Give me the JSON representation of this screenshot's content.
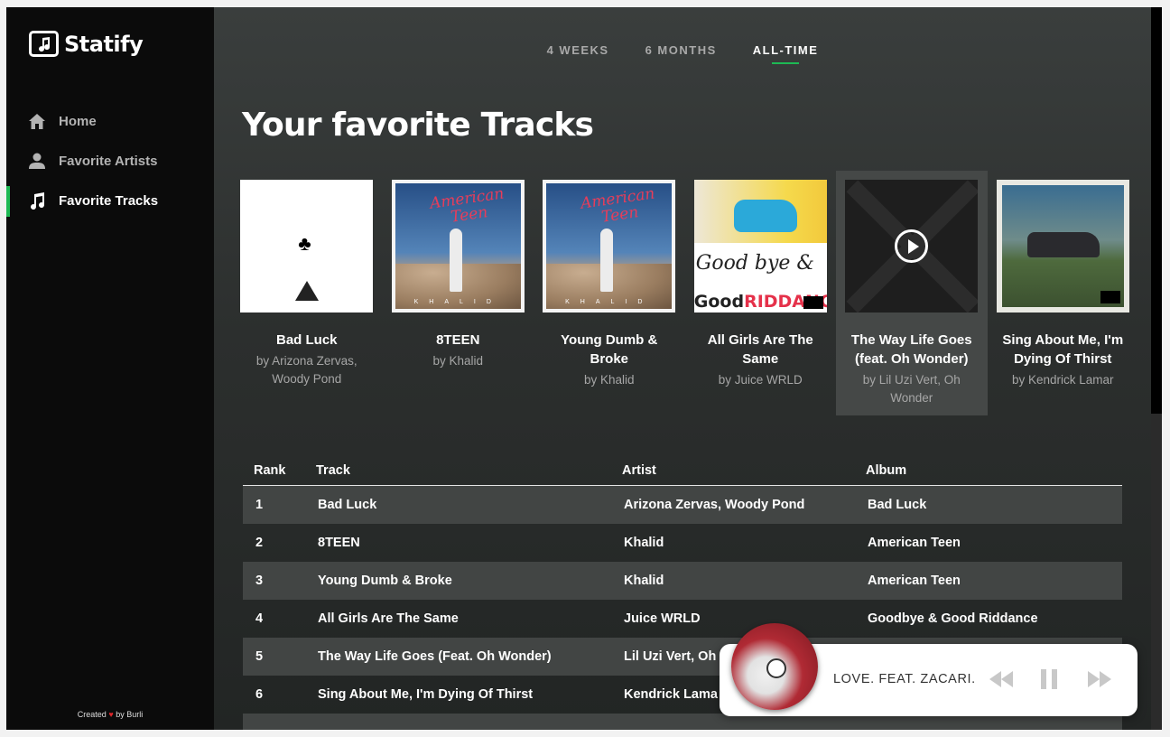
{
  "app": {
    "name": "Statify"
  },
  "sidebar": {
    "items": [
      {
        "label": "Home",
        "icon": "home-icon",
        "active": false
      },
      {
        "label": "Favorite Artists",
        "icon": "person-icon",
        "active": false
      },
      {
        "label": "Favorite Tracks",
        "icon": "music-note-icon",
        "active": true
      }
    ],
    "credit": {
      "prefix": "Created",
      "suffix": "by Burli"
    }
  },
  "tabs": [
    {
      "label": "4 WEEKS",
      "active": false
    },
    {
      "label": "6 MONTHS",
      "active": false
    },
    {
      "label": "ALL-TIME",
      "active": true
    }
  ],
  "page_title": "Your favorite Tracks",
  "cards": [
    {
      "title": "Bad Luck",
      "artist": "by Arizona Zervas, Woody Pond"
    },
    {
      "title": "8TEEN",
      "artist": "by Khalid"
    },
    {
      "title": "Young Dumb & Broke",
      "artist": "by Khalid"
    },
    {
      "title": "All Girls Are The Same",
      "artist": "by Juice WRLD"
    },
    {
      "title": "The Way Life Goes (feat. Oh Wonder)",
      "artist": "by Lil Uzi Vert, Oh Wonder"
    },
    {
      "title": "Sing About Me, I'm Dying Of Thirst",
      "artist": "by Kendrick Lamar"
    }
  ],
  "covers": {
    "american_teen_script": "American Teen",
    "khalid_letters": "KHALID",
    "goodbye_script": "Good bye &",
    "good_word": "Good",
    "riddance_word": "RIDDANCE"
  },
  "table": {
    "headers": {
      "rank": "Rank",
      "track": "Track",
      "artist": "Artist",
      "album": "Album"
    },
    "rows": [
      {
        "rank": "1",
        "track": "Bad Luck",
        "artist": "Arizona Zervas, Woody Pond",
        "album": "Bad Luck"
      },
      {
        "rank": "2",
        "track": "8TEEN",
        "artist": "Khalid",
        "album": "American Teen"
      },
      {
        "rank": "3",
        "track": "Young Dumb & Broke",
        "artist": "Khalid",
        "album": "American Teen"
      },
      {
        "rank": "4",
        "track": "All Girls Are The Same",
        "artist": "Juice WRLD",
        "album": "Goodbye & Good Riddance"
      },
      {
        "rank": "5",
        "track": "The Way Life Goes (Feat. Oh Wonder)",
        "artist": "Lil Uzi Vert, Oh",
        "album": ""
      },
      {
        "rank": "6",
        "track": "Sing About Me, I'm Dying Of Thirst",
        "artist": "Kendrick Lama",
        "album": ""
      }
    ]
  },
  "player": {
    "now_playing": "LOVE. FEAT. ZACARI.",
    "controls": [
      "rewind-icon",
      "pause-icon",
      "fast-forward-icon"
    ]
  },
  "colors": {
    "accent": "#1db954",
    "sidebar_bg": "#0b0b0b",
    "main_bg": "#2c2f2e"
  }
}
